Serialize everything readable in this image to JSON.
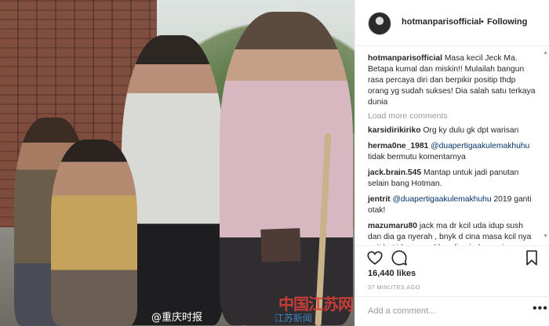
{
  "photo": {
    "watermark_left": "@重庆时报",
    "watermark_right": "中国江苏网",
    "watermark_right_sub": "江苏新闻"
  },
  "header": {
    "username": "hotmanparisofficial",
    "separator": "•",
    "follow_label": "Following"
  },
  "caption": {
    "username": "hotmanparisofficial",
    "text": "Masa kecil Jeck Ma. Betapa kumal dan miskin!! Mulailah bangun rasa percaya diri dan berpikir positip thdp orang yg sudah sukses! Dia salah satu terkaya dunia"
  },
  "load_more": "Load more comments",
  "comments": [
    {
      "username": "karsidirikiriko",
      "pre": "",
      "mention": "",
      "text": "Org ky dulu gk dpt warisan"
    },
    {
      "username": "herma0ne_1981",
      "pre": "",
      "mention": "@duapertigaakulemakhuhu",
      "text": "tidak bermutu komentarnya"
    },
    {
      "username": "jack.brain.545",
      "pre": "",
      "mention": "",
      "text": "Mantap untuk jadi panutan selain bang Hotman."
    },
    {
      "username": "jentrit",
      "pre": "",
      "mention": "@duapertigaakulemakhuhu",
      "text": "2019 ganti otak!"
    },
    {
      "username": "mazumaru80",
      "pre": "",
      "mention": "",
      "text": "jack ma dr kcil uda idup sush dan dia ga nyerah , bnyk d cina masa kcil nya pait bgt iduonya ..d banding indo masi"
    }
  ],
  "likes": "16,440 likes",
  "time_ago": "37 MINUTES AGO",
  "add_comment_placeholder": "Add a comment...",
  "more_label": "•••",
  "icons": {
    "like": "heart-icon",
    "comment": "comment-icon",
    "share": "share-icon",
    "save": "bookmark-icon"
  }
}
